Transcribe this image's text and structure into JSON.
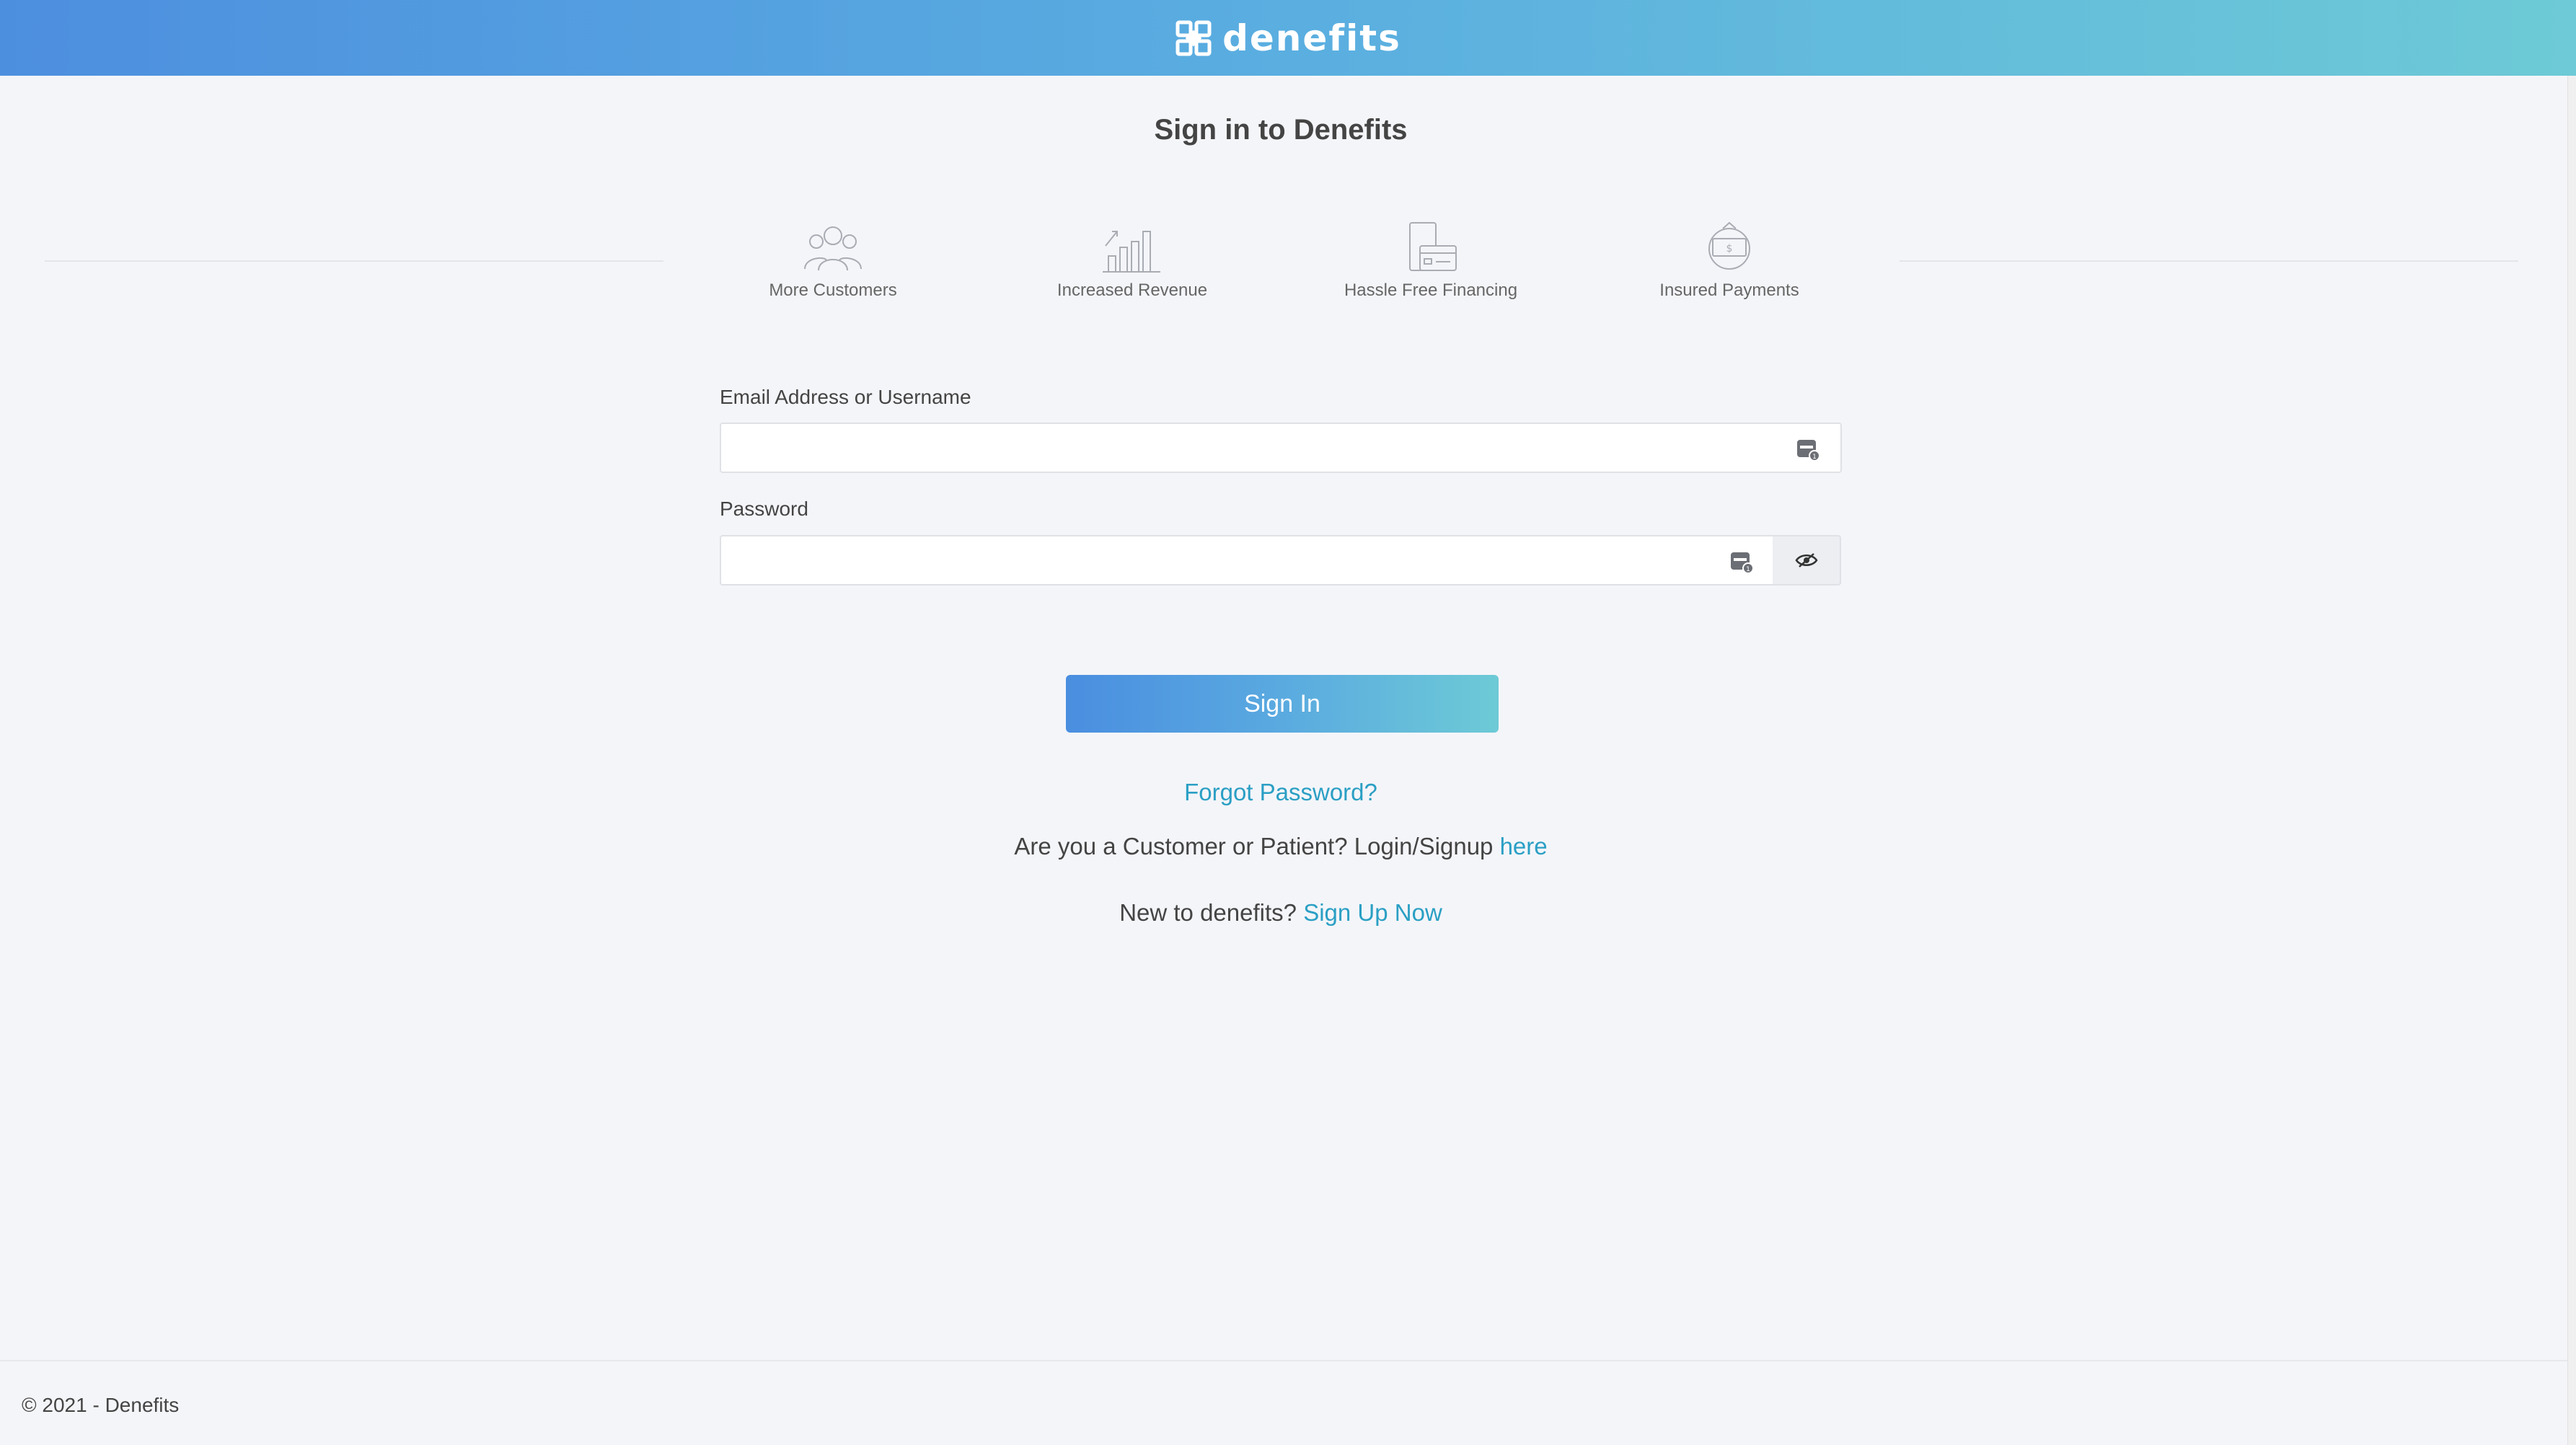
{
  "header": {
    "brand": "denefits",
    "logo_icon": "denefits-logo-icon"
  },
  "page": {
    "title": "Sign in to Denefits"
  },
  "features": [
    {
      "label": "More Customers",
      "icon": "customers-icon"
    },
    {
      "label": "Increased Revenue",
      "icon": "bar-chart-icon"
    },
    {
      "label": "Hassle Free Financing",
      "icon": "financing-icon"
    },
    {
      "label": "Insured Payments",
      "icon": "insured-payment-icon"
    }
  ],
  "form": {
    "email_label": "Email Address or Username",
    "email_value": "",
    "password_label": "Password",
    "password_value": "",
    "signin_label": "Sign In"
  },
  "links": {
    "forgot": "Forgot Password?",
    "customer_prefix": "Are you a Customer or Patient? Login/Signup ",
    "customer_link": "here",
    "new_prefix": "New to denefits? ",
    "signup_link": "Sign Up Now"
  },
  "footer": {
    "copyright": "© 2021 - Denefits"
  },
  "colors": {
    "link": "#2a9fc4",
    "gradient_start": "#4d8fdf",
    "gradient_end": "#6dcad6",
    "background": "#f4f5f9"
  }
}
